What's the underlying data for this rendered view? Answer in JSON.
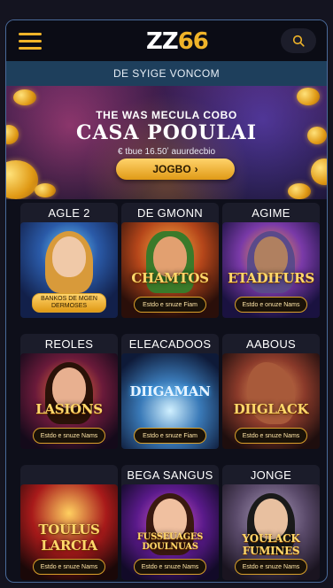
{
  "header": {
    "logo_prefix": "ZZ",
    "logo_number": "66",
    "menu_icon": "hamburger-menu-icon",
    "search_icon": "search-icon"
  },
  "subbar": {
    "text": "DE SYIGE VONCOM"
  },
  "hero": {
    "top_line": "THE WAS MECULA COBO",
    "title": "CASA POOULAI",
    "subtitle": "€ tbue 16.50ʼ auurdecbio",
    "button_label": "JOGBO",
    "button_arrow": "›"
  },
  "games": [
    {
      "title": "AGLE 2",
      "image_text": "",
      "button": "BANKOS DE MGEN DERMOSES",
      "button_style": "filled"
    },
    {
      "title": "DE GMONN",
      "image_text": "CHAMTOS",
      "button": "Estdo e snuze Fiam",
      "button_style": "outline"
    },
    {
      "title": "AGIME",
      "image_text": "ETADIFURS",
      "button": "Estdo e onuze Nams",
      "button_style": "outline"
    },
    {
      "title": "REOLES",
      "image_text": "LASIONS",
      "button": "Estdo e snuze Nams",
      "button_style": "outline"
    },
    {
      "title": "ELEACADOOS",
      "image_text": "DIIGAMAN",
      "button": "Estdo e snuze Fiam",
      "button_style": "outline"
    },
    {
      "title": "AABOUS",
      "image_text": "DIIGLACK",
      "button": "Estdo e snuze Nams",
      "button_style": "outline"
    },
    {
      "title": "",
      "image_text": "TOULUS LARCIA",
      "button": "Estdo e snuze Nams",
      "button_style": "outline"
    },
    {
      "title": "BEGA SANGUS",
      "image_text": "FUSSEUAGES DOULNUAS",
      "button": "Estdo e snuze Nams",
      "button_style": "outline"
    },
    {
      "title": "JONGE",
      "image_text": "YOULACK FUMINES",
      "button": "Estdo e snuze Nams",
      "button_style": "outline"
    }
  ],
  "colors": {
    "accent": "#f0b429",
    "subbar": "#1e3f5c",
    "frame_border": "#4a6a9a",
    "background": "#0e0f1a"
  }
}
